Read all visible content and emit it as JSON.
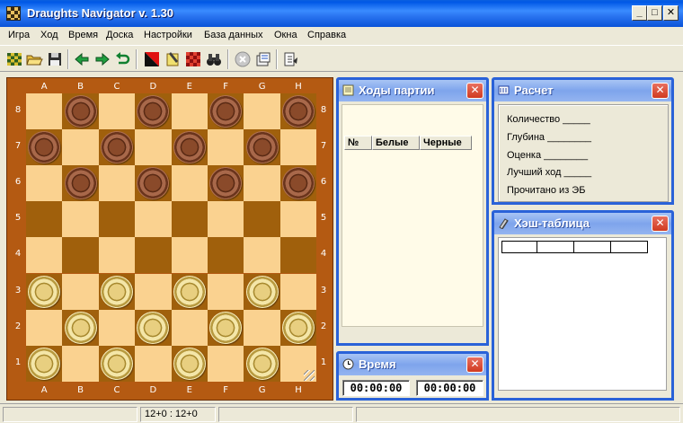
{
  "window": {
    "title": "Draughts Navigator v. 1.30",
    "minimize_label": "_",
    "maximize_label": "□",
    "close_label": "✕"
  },
  "menu": [
    "Игра",
    "Ход",
    "Время",
    "Доска",
    "Настройки",
    "База данных",
    "Окна",
    "Справка"
  ],
  "toolbar": {
    "icons": [
      "new-board-icon",
      "open-folder-icon",
      "save-icon",
      "arrow-left-icon",
      "arrow-right-icon",
      "undo-icon",
      "flip-board-icon",
      "edit-position-icon",
      "board-pattern-icon",
      "binoculars-icon",
      "stop-icon",
      "properties-icon",
      "export-icon"
    ]
  },
  "board": {
    "files": [
      "A",
      "B",
      "C",
      "D",
      "E",
      "F",
      "G",
      "H"
    ],
    "ranks": [
      "8",
      "7",
      "6",
      "5",
      "4",
      "3",
      "2",
      "1"
    ],
    "dark_pieces": [
      "b8",
      "d8",
      "f8",
      "h8",
      "a7",
      "c7",
      "e7",
      "g7",
      "b6",
      "d6",
      "f6",
      "h6"
    ],
    "light_pieces": [
      "a3",
      "c3",
      "e3",
      "g3",
      "b2",
      "d2",
      "f2",
      "h2",
      "a1",
      "c1",
      "e1",
      "g1"
    ],
    "colors": {
      "light_square": "#fad290",
      "dark_square": "#a0600c",
      "frame": "#b45a12"
    }
  },
  "moves_panel": {
    "title": "Ходы партии",
    "columns": [
      "№",
      "Белые",
      "Черные"
    ]
  },
  "calc_panel": {
    "title": "Расчет",
    "lines": [
      "Количество _____",
      "Глубина ________",
      "Оценка ________",
      "Лучший ход _____",
      "Прочитано из ЭБ"
    ]
  },
  "hash_panel": {
    "title": "Хэш-таблица"
  },
  "time_panel": {
    "title": "Время",
    "white_time": "00:00:00",
    "black_time": "00:00:00"
  },
  "status": {
    "cells": [
      "",
      "12+0 : 12+0",
      "",
      ""
    ]
  },
  "accent": "#2a62d8"
}
